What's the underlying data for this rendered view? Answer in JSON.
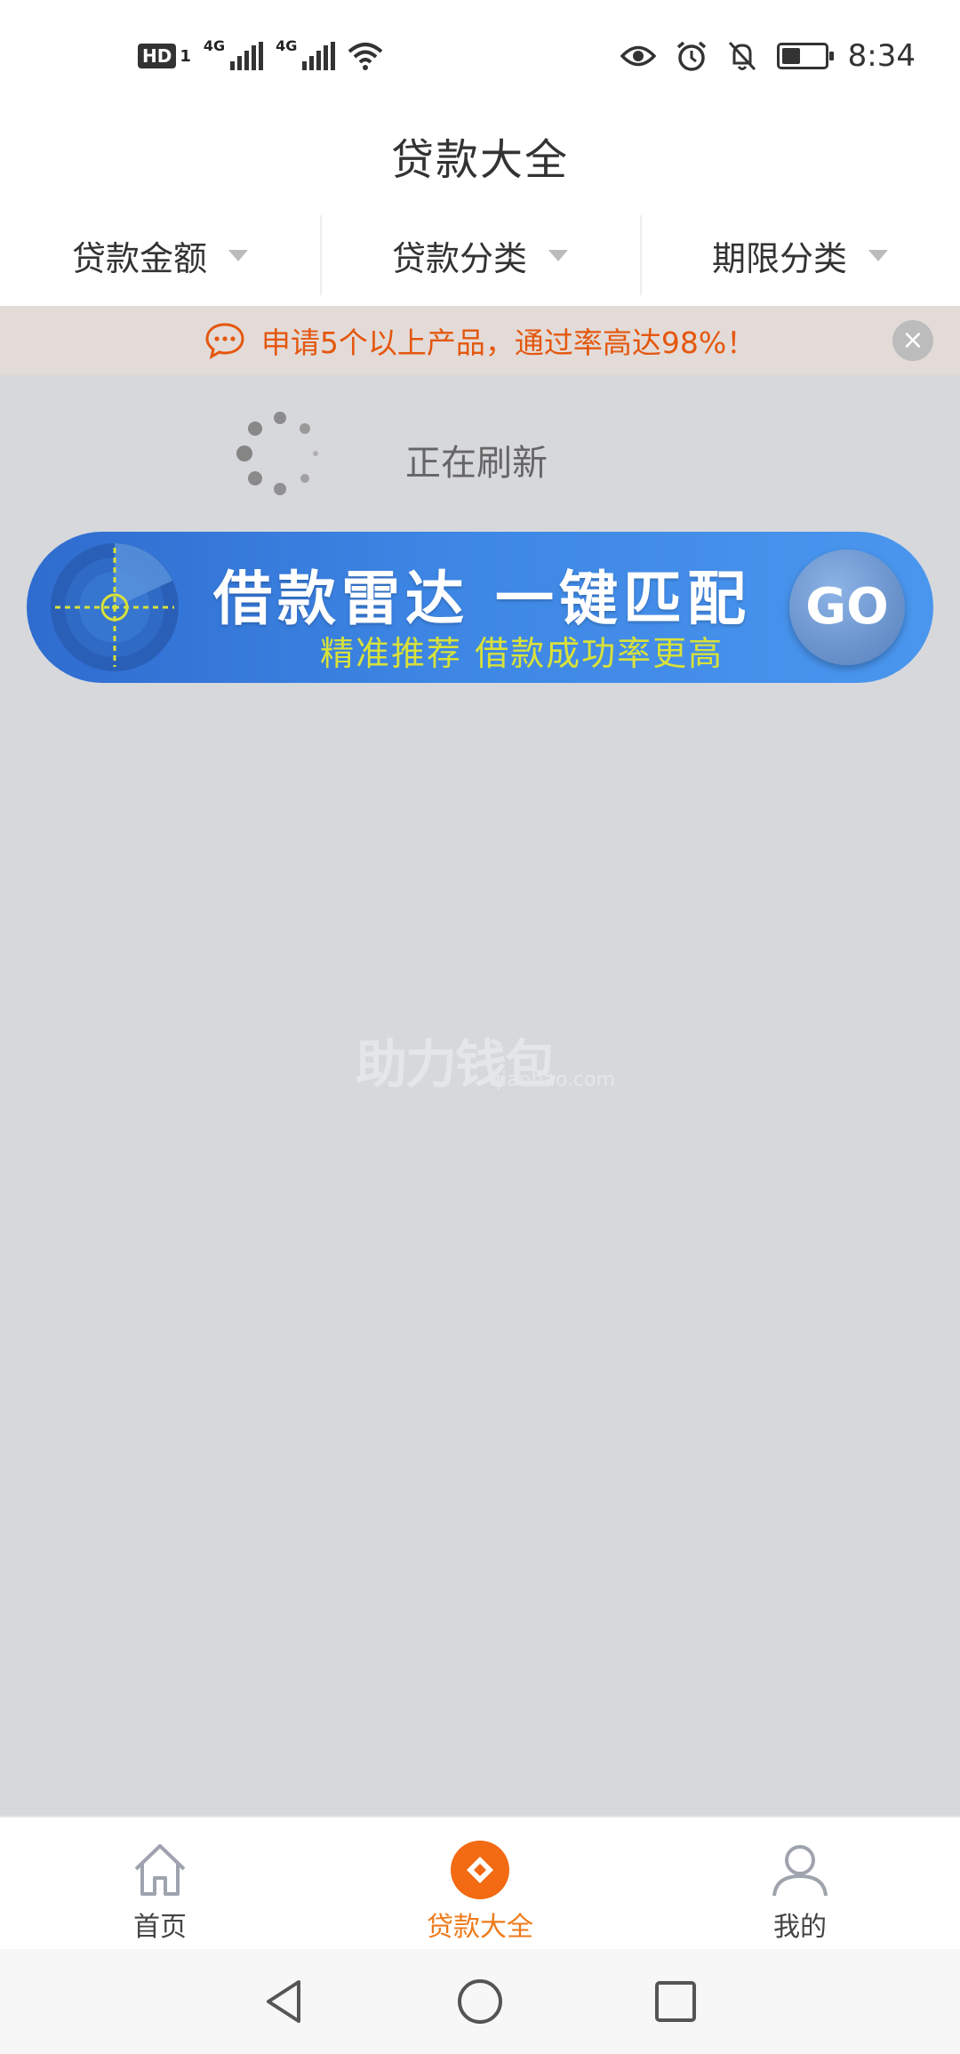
{
  "status_bar": {
    "hd": "HD",
    "sim": "1",
    "net1": "4G",
    "net2": "4G",
    "time": "8:34",
    "battery_level": 0.45
  },
  "header": {
    "title": "贷款大全"
  },
  "filters": [
    {
      "label": "贷款金额"
    },
    {
      "label": "贷款分类"
    },
    {
      "label": "期限分类"
    }
  ],
  "notice": {
    "text": "申请5个以上产品，通过率高达98%！",
    "close": "×"
  },
  "refresh": {
    "text": "正在刷新"
  },
  "banner": {
    "title": "借款雷达  一键匹配",
    "subtitle": "精准推荐  借款成功率更高",
    "go": "GO"
  },
  "watermark": {
    "logo": "助力钱包",
    "url": "qianbao.com"
  },
  "tabs": [
    {
      "label": "首页",
      "icon": "home-icon",
      "active": false
    },
    {
      "label": "贷款大全",
      "icon": "loan-diamond-icon",
      "active": true
    },
    {
      "label": "我的",
      "icon": "user-icon",
      "active": false
    }
  ],
  "colors": {
    "accent": "#ee7a1a",
    "notice_text": "#e4570e",
    "banner_blue": "#3d86e4",
    "banner_subtitle": "#d8e13a",
    "background": "#d6d8dc"
  }
}
